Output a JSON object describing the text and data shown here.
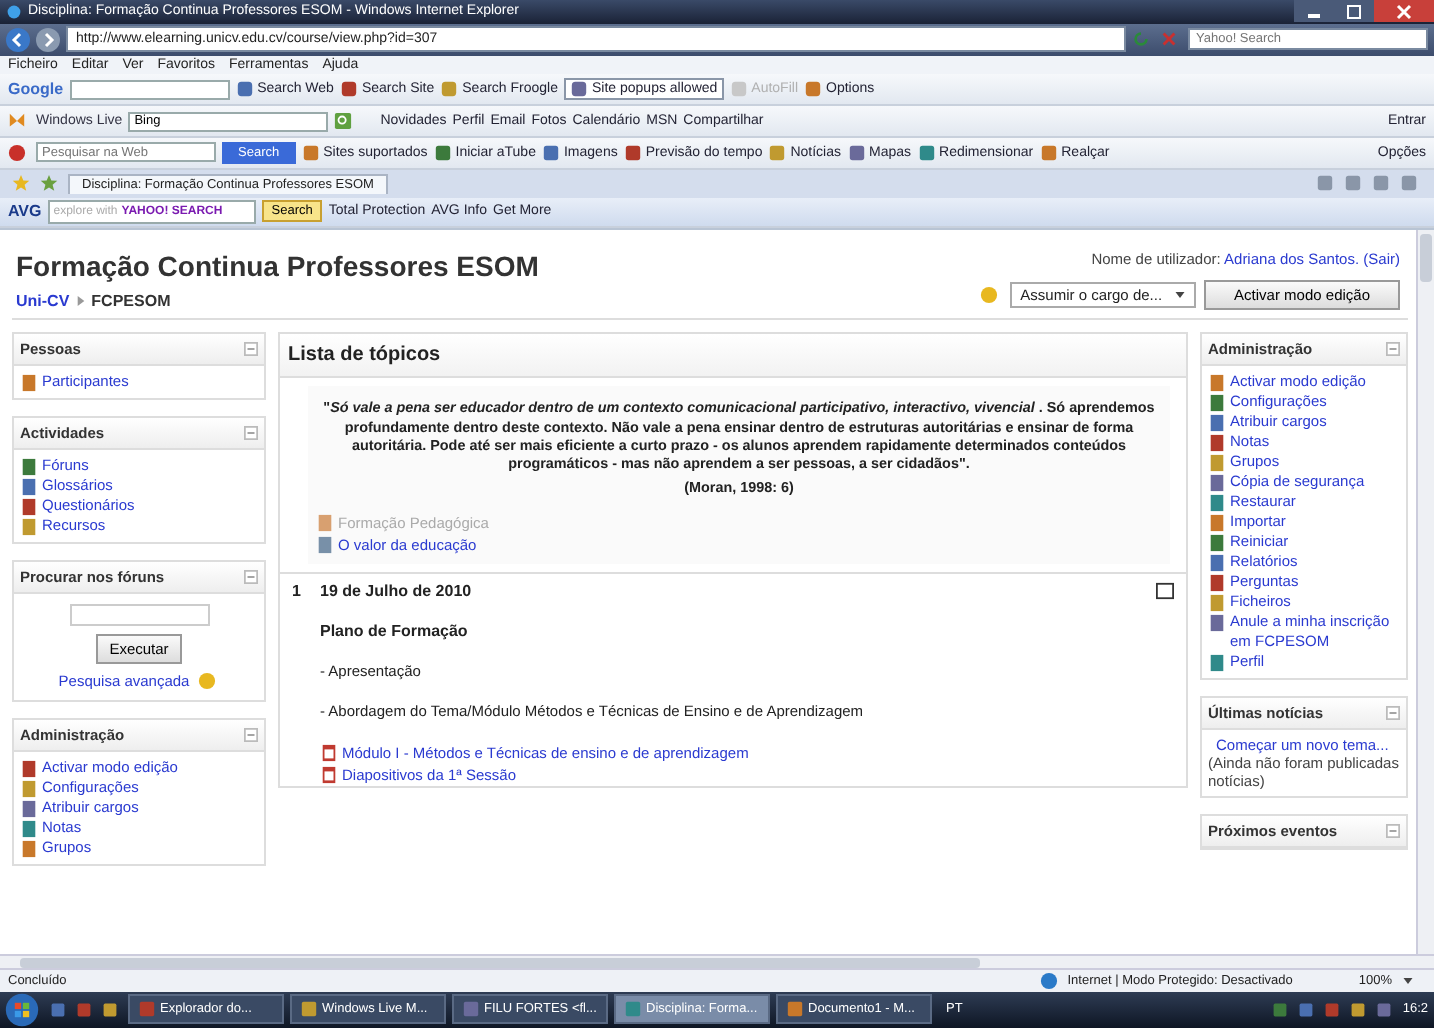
{
  "window": {
    "title": "Disciplina: Formação Continua Professores ESOM - Windows Internet Explorer"
  },
  "address_bar": {
    "url": "http://www.elearning.unicv.edu.cv/course/view.php?id=307",
    "search_placeholder": "Yahoo! Search"
  },
  "menu": [
    "Ficheiro",
    "Editar",
    "Ver",
    "Favoritos",
    "Ferramentas",
    "Ajuda"
  ],
  "google_toolbar": {
    "logo": "Google",
    "items": [
      {
        "label": "Search Web",
        "disabled": false
      },
      {
        "label": "Search Site",
        "disabled": false
      },
      {
        "label": "Search Froogle",
        "disabled": false
      },
      {
        "label": "Site popups allowed",
        "disabled": false
      },
      {
        "label": "AutoFill",
        "disabled": true
      },
      {
        "label": "Options",
        "disabled": false
      }
    ]
  },
  "live_toolbar": {
    "brand": "Windows Live",
    "search_value": "Bing",
    "links": [
      "Novidades",
      "Perfil",
      "Email",
      "Fotos",
      "Calendário",
      "MSN",
      "Compartilhar"
    ],
    "sign_in": "Entrar"
  },
  "search_toolbar": {
    "placeholder": "Pesquisar na Web",
    "button": "Search",
    "items": [
      "Sites suportados",
      "Iniciar aTube",
      "Imagens",
      "Previsão do tempo",
      "Notícias",
      "Mapas",
      "Redimensionar",
      "Realçar"
    ],
    "options": "Opções"
  },
  "tabs": [
    {
      "label": "Disciplina: Formação Continua Professores ESOM",
      "selected": true
    }
  ],
  "avg_toolbar": {
    "brand": "AVG",
    "placeholder": "explore with",
    "logo": "YAHOO! SEARCH",
    "button": "Search",
    "items": [
      "Total Protection",
      "AVG Info",
      "Get More"
    ]
  },
  "page": {
    "title": "Formação Continua Professores ESOM",
    "breadcrumb": [
      "Uni-CV",
      "FCPESOM"
    ],
    "login_label": "Nome de utilizador:",
    "user": "Adriana dos Santos.",
    "logout": "(Sair)",
    "role_select": "Assumir o cargo de...",
    "edit_button": "Activar modo edição"
  },
  "left_blocks": [
    {
      "kind": "links",
      "title": "Pessoas",
      "items": [
        "Participantes"
      ]
    },
    {
      "kind": "links",
      "title": "Actividades",
      "items": [
        "Fóruns",
        "Glossários",
        "Questionários",
        "Recursos"
      ]
    },
    {
      "kind": "search",
      "title": "Procurar nos fóruns",
      "button": "Executar",
      "link": "Pesquisa avançada"
    },
    {
      "kind": "links",
      "title": "Administração",
      "items": [
        "Activar modo edição",
        "Configurações",
        "Atribuir cargos",
        "Notas",
        "Grupos"
      ]
    }
  ],
  "topics": {
    "title": "Lista de tópicos",
    "quote": "\"*Só vale a pena ser educador dentro de um contexto comunicacional participativo, interactivo, vivencial* . Só aprendemos profundamente dentro deste contexto. Não vale a pena ensinar dentro de estruturas autoritárias e ensinar de forma autoritária. Pode até ser mais eficiente a curto prazo - os alunos aprendem rapidamente determinados conteúdos programáticos - mas não aprendem a ser pessoas, a ser cidadãos\".",
    "citation": "(Moran, 1998: 6)",
    "resources": [
      {
        "label": "Formação Pedagógica",
        "disabled": true
      },
      {
        "label": "O valor da educação",
        "disabled": false
      }
    ],
    "section": {
      "number": "1",
      "date": "19 de Julho de 2010",
      "heading": "Plano de Formação",
      "lines": [
        "- Apresentação",
        "- Abordagem do Tema/Módulo Métodos e Técnicas de Ensino e de Aprendizagem"
      ],
      "resources": [
        "Módulo I - Métodos e Técnicas de ensino e de aprendizagem",
        "Diapositivos da 1ª Sessão"
      ]
    }
  },
  "right_blocks": [
    {
      "kind": "links",
      "title": "Administração",
      "items": [
        "Activar modo edição",
        "Configurações",
        "Atribuir cargos",
        "Notas",
        "Grupos",
        "Cópia de segurança",
        "Restaurar",
        "Importar",
        "Reiniciar",
        "Relatórios",
        "Perguntas",
        "Ficheiros",
        "Anule a minha inscrição em FCPESOM",
        "Perfil"
      ]
    },
    {
      "kind": "news",
      "title": "Últimas notícias",
      "link": "Começar um novo tema...",
      "note": "(Ainda não foram publicadas notícias)"
    },
    {
      "kind": "header",
      "title": "Próximos eventos"
    }
  ],
  "status_bar": {
    "text": "Concluído",
    "zone": "Internet | Modo Protegido: Desactivado",
    "zoom": "100%"
  },
  "taskbar": {
    "items": [
      {
        "label": "Explorador do...",
        "selected": false
      },
      {
        "label": "Windows Live M...",
        "selected": false
      },
      {
        "label": "FILU FORTES <fl...",
        "selected": false
      },
      {
        "label": "Disciplina: Forma...",
        "selected": true
      },
      {
        "label": "Documento1 - M...",
        "selected": false
      }
    ],
    "language": "PT",
    "clock": "16:2"
  }
}
